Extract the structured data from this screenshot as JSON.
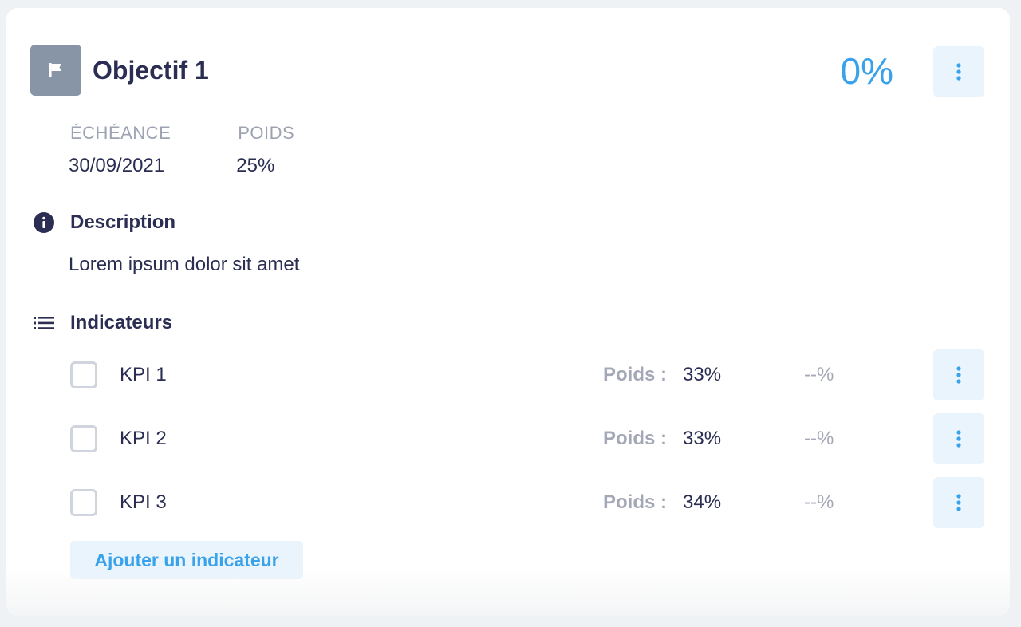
{
  "objective": {
    "title": "Objectif 1",
    "progress": "0%",
    "flag_icon": "flag-icon",
    "menu_icon": "more-vertical-icon"
  },
  "meta": {
    "deadline_label": "ÉCHÉANCE",
    "deadline_value": "30/09/2021",
    "weight_label": "POIDS",
    "weight_value": "25%"
  },
  "description": {
    "icon": "info-icon",
    "title": "Description",
    "text": "Lorem ipsum dolor sit amet"
  },
  "indicators": {
    "icon": "list-icon",
    "title": "Indicateurs",
    "weight_prefix": "Poids :",
    "items": [
      {
        "name": "KPI 1",
        "weight": "33%",
        "progress": "--%"
      },
      {
        "name": "KPI 2",
        "weight": "33%",
        "progress": "--%"
      },
      {
        "name": "KPI 3",
        "weight": "34%",
        "progress": "--%"
      }
    ],
    "add_label": "Ajouter un indicateur"
  },
  "colors": {
    "accent": "#3aa2ea",
    "text_dark": "#2b2d52",
    "muted": "#9ea3b2",
    "flag_bg": "#8795a6",
    "button_bg": "#e9f4fd"
  }
}
